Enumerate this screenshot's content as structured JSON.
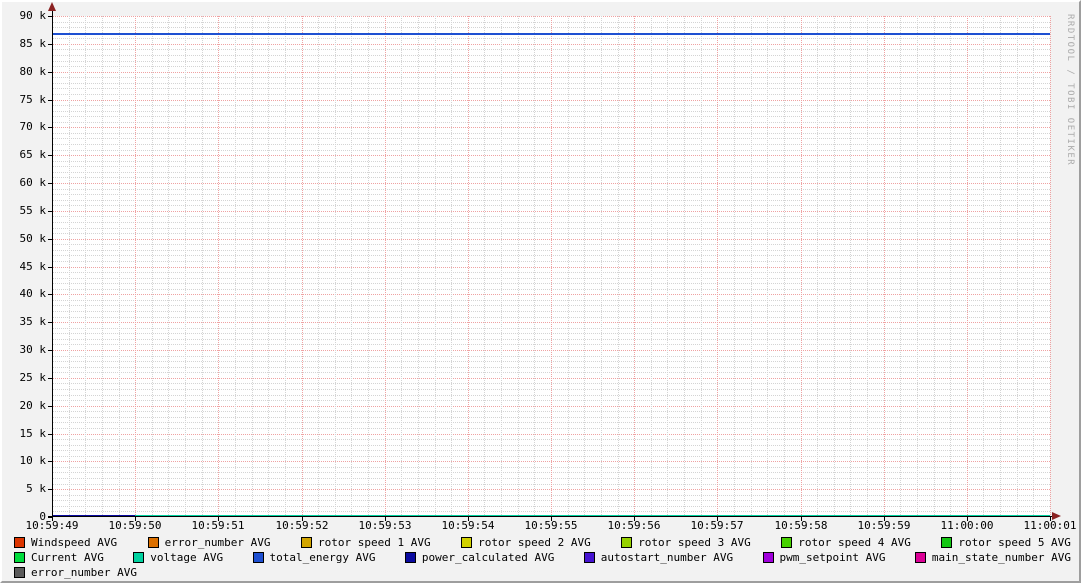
{
  "watermark": "RRDTOOL / TOBI OETIKER",
  "colors": {
    "canvas_bg": "#F2F2F2",
    "plot_bg": "#FFFFFF",
    "axis": "#000000",
    "arrow": "#8B2222",
    "grid_major": "#EFA2A2",
    "grid_minor": "#D4D4D4",
    "watermark_text": "#ABABAB",
    "bevel_light": "#FFFFFF",
    "bevel_dark": "#9E9E9E"
  },
  "chart_data": {
    "type": "line",
    "title": "",
    "xlabel": "",
    "ylabel": "",
    "grid": true,
    "legend_position": "bottom",
    "consolidation": "AVG",
    "x": [
      "10:59:49",
      "10:59:50",
      "10:59:51",
      "10:59:52",
      "10:59:53",
      "10:59:54",
      "10:59:55",
      "10:59:56",
      "10:59:57",
      "10:59:58",
      "10:59:59",
      "11:00:00",
      "11:00:01"
    ],
    "ylim": [
      0,
      90000
    ],
    "ytick_step": 5000,
    "minor_step": 1000,
    "x_minor_divisions": 60,
    "yticks": [
      {
        "value": 0,
        "label": "0"
      },
      {
        "value": 5000,
        "label": "5 k"
      },
      {
        "value": 10000,
        "label": "10 k"
      },
      {
        "value": 15000,
        "label": "15 k"
      },
      {
        "value": 20000,
        "label": "20 k"
      },
      {
        "value": 25000,
        "label": "25 k"
      },
      {
        "value": 30000,
        "label": "30 k"
      },
      {
        "value": 35000,
        "label": "35 k"
      },
      {
        "value": 40000,
        "label": "40 k"
      },
      {
        "value": 45000,
        "label": "45 k"
      },
      {
        "value": 50000,
        "label": "50 k"
      },
      {
        "value": 55000,
        "label": "55 k"
      },
      {
        "value": 60000,
        "label": "60 k"
      },
      {
        "value": 65000,
        "label": "65 k"
      },
      {
        "value": 70000,
        "label": "70 k"
      },
      {
        "value": 75000,
        "label": "75 k"
      },
      {
        "value": 80000,
        "label": "80 k"
      },
      {
        "value": 85000,
        "label": "85 k"
      },
      {
        "value": 90000,
        "label": "90 k"
      }
    ],
    "series": [
      {
        "name": "Windspeed",
        "color": "#DC3500",
        "values": [
          null,
          null,
          null,
          null,
          null,
          null,
          null,
          null,
          null,
          null,
          null,
          null,
          null
        ]
      },
      {
        "name": "error_number",
        "color": "#DC7000",
        "values": [
          null,
          null,
          null,
          null,
          null,
          null,
          null,
          null,
          null,
          null,
          null,
          null,
          null
        ]
      },
      {
        "name": "rotor speed 1",
        "color": "#D2A500",
        "values": [
          null,
          null,
          null,
          null,
          null,
          null,
          null,
          null,
          null,
          null,
          null,
          null,
          null
        ]
      },
      {
        "name": "rotor speed 2",
        "color": "#D2D200",
        "values": [
          null,
          null,
          null,
          null,
          null,
          null,
          null,
          null,
          null,
          null,
          null,
          null,
          null
        ]
      },
      {
        "name": "rotor speed 3",
        "color": "#96D200",
        "values": [
          null,
          null,
          null,
          null,
          null,
          null,
          null,
          null,
          null,
          null,
          null,
          null,
          null
        ]
      },
      {
        "name": "rotor speed 4",
        "color": "#46D200",
        "values": [
          null,
          null,
          null,
          null,
          null,
          null,
          null,
          null,
          null,
          null,
          null,
          null,
          null
        ]
      },
      {
        "name": "rotor speed 5",
        "color": "#14C814",
        "values": [
          null,
          null,
          null,
          null,
          null,
          null,
          null,
          null,
          null,
          null,
          null,
          null,
          null
        ]
      },
      {
        "name": "Current",
        "color": "#00DC3C",
        "values": [
          null,
          null,
          null,
          null,
          null,
          null,
          null,
          null,
          null,
          null,
          null,
          null,
          null
        ]
      },
      {
        "name": "voltage",
        "color": "#00D2A0",
        "values": [
          null,
          0,
          0,
          0,
          0,
          0,
          0,
          0,
          0,
          0,
          0,
          0,
          0
        ]
      },
      {
        "name": "total_energy",
        "color": "#1E50D2",
        "values": [
          86600,
          86600,
          86600,
          86600,
          86600,
          86600,
          86600,
          86600,
          86600,
          86600,
          86600,
          86600,
          86600
        ]
      },
      {
        "name": "power_calculated",
        "color": "#0A0AA0",
        "values": [
          0,
          0,
          null,
          null,
          null,
          null,
          null,
          null,
          null,
          null,
          null,
          null,
          null
        ]
      },
      {
        "name": "autostart_number",
        "color": "#4614D2",
        "values": [
          null,
          null,
          null,
          null,
          null,
          null,
          null,
          null,
          null,
          null,
          null,
          null,
          null
        ]
      },
      {
        "name": "pwm_setpoint",
        "color": "#A000DC",
        "values": [
          null,
          null,
          null,
          null,
          null,
          null,
          null,
          null,
          null,
          null,
          null,
          null,
          null
        ]
      },
      {
        "name": "main_state_number",
        "color": "#DC0096",
        "values": [
          null,
          null,
          null,
          null,
          null,
          null,
          null,
          null,
          null,
          null,
          null,
          null,
          null
        ]
      },
      {
        "name": "error_number",
        "color": "#5A5A5A",
        "values": [
          null,
          null,
          null,
          null,
          null,
          null,
          null,
          null,
          null,
          null,
          null,
          null,
          null
        ]
      }
    ],
    "legend_row_chunks": [
      7,
      7,
      1
    ]
  }
}
